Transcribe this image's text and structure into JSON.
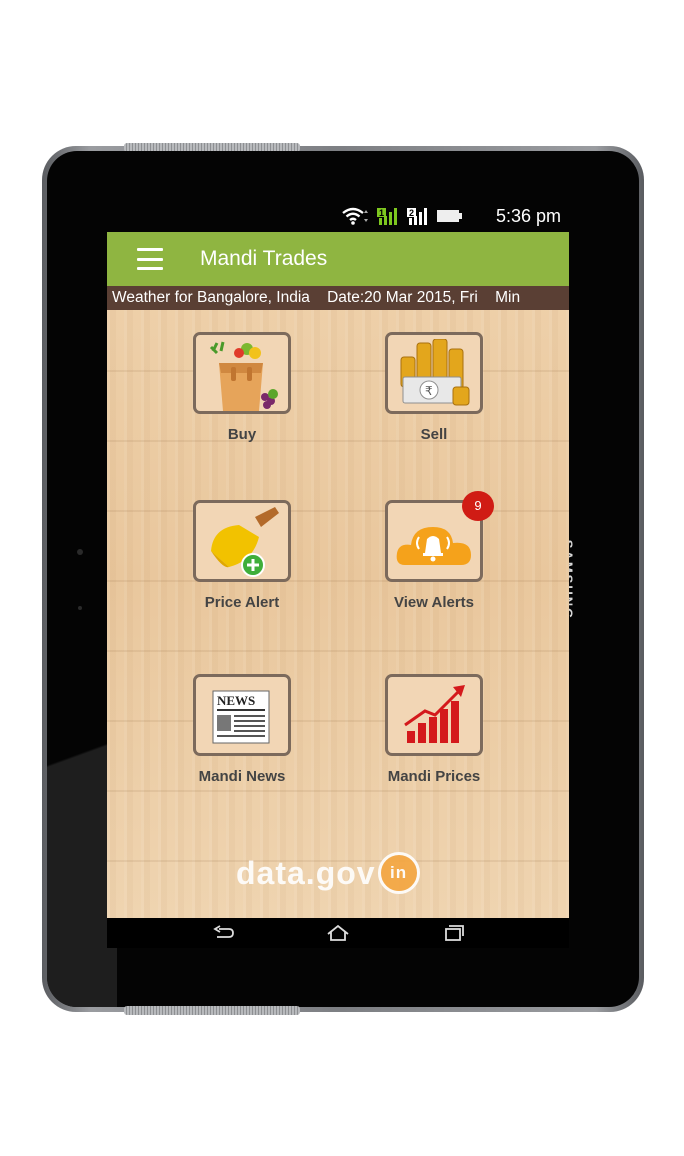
{
  "device": {
    "brand": "SAMSUNG"
  },
  "status_bar": {
    "time": "5:36 pm",
    "icons": [
      "wifi-icon",
      "signal-sim1-icon",
      "signal-sim2-icon",
      "battery-icon"
    ]
  },
  "app_bar": {
    "title": "Mandi Trades",
    "menu_icon": "hamburger-menu-icon"
  },
  "ticker": {
    "text": "Weather for Bangalore, India    Date:20 Mar 2015, Fri    Min"
  },
  "tiles": [
    {
      "label": "Buy",
      "icon": "grocery-bag-icon"
    },
    {
      "label": "Sell",
      "icon": "coins-cash-icon"
    },
    {
      "label": "Price Alert",
      "icon": "bell-add-icon"
    },
    {
      "label": "View Alerts",
      "icon": "cloud-bell-icon",
      "badge": "9"
    },
    {
      "label": "Mandi News",
      "icon": "newspaper-icon"
    },
    {
      "label": "Mandi Prices",
      "icon": "rising-chart-icon"
    }
  ],
  "footer": {
    "logo_text": "data.gov",
    "logo_badge": "in"
  },
  "nav_bar": {
    "icons": [
      "back-icon",
      "home-icon",
      "recent-apps-icon"
    ]
  },
  "colors": {
    "app_bar": "#8fb541",
    "ticker": "#5a3f34",
    "badge": "#d01c14"
  }
}
